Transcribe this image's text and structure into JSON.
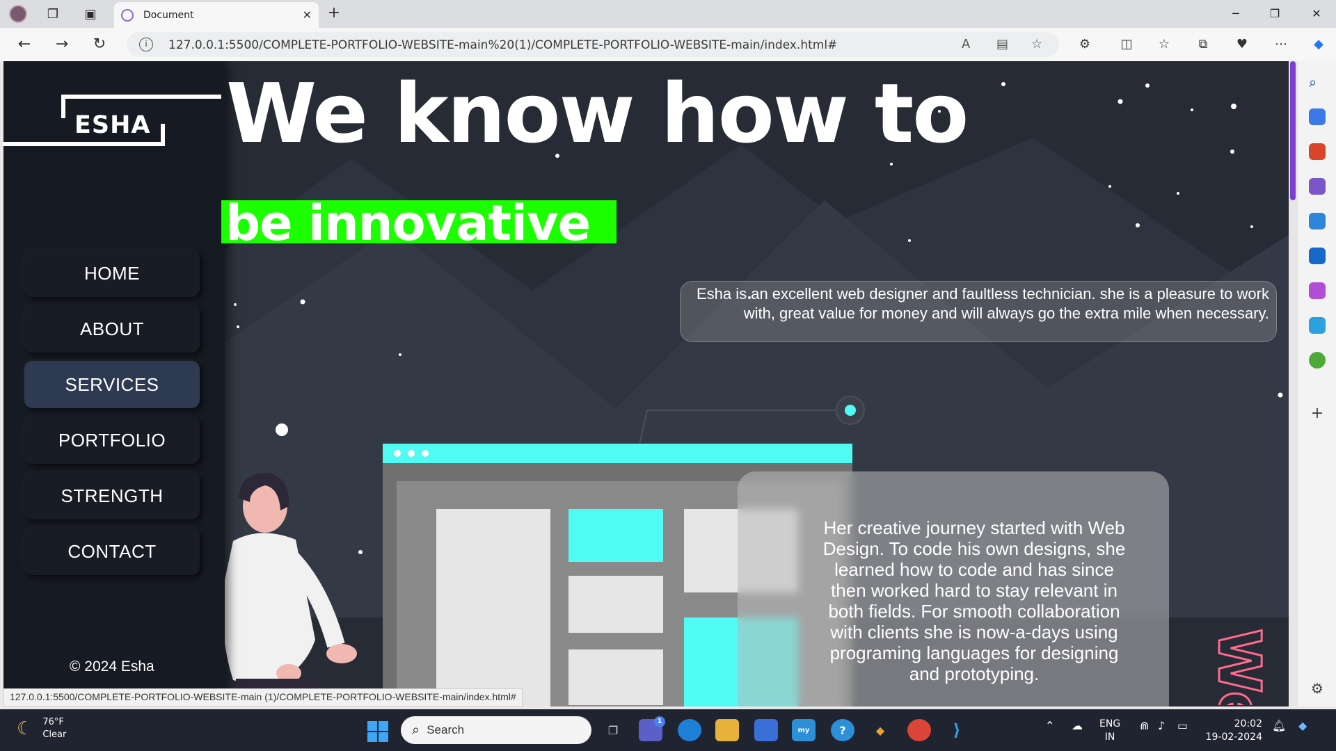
{
  "browser": {
    "tab_title": "Document",
    "url": "127.0.0.1:5500/COMPLETE-PORTFOLIO-WEBSITE-main%20(1)/COMPLETE-PORTFOLIO-WEBSITE-main/index.html#",
    "status_url": "127.0.0.1:5500/COMPLETE-PORTFOLIO-WEBSITE-main (1)/COMPLETE-PORTFOLIO-WEBSITE-main/index.html#"
  },
  "site": {
    "logo": "ESHA",
    "nav": [
      {
        "label": "HOME"
      },
      {
        "label": "ABOUT"
      },
      {
        "label": "SERVICES"
      },
      {
        "label": "PORTFOLIO"
      },
      {
        "label": "STRENGTH"
      },
      {
        "label": "CONTACT"
      }
    ],
    "active_nav": "SERVICES",
    "copyright": "© 2024 Esha",
    "headline": "We know how to",
    "subheadline": "be innovative",
    "quote": "Esha is an excellent web designer and faultless technician. she is a pleasure to work with, great value for money and will always go the extra mile when necessary.",
    "story": "Her creative journey started with Web Design. To code his own designs, she learned how to code and has since then worked hard to stay relevant in both fields. For smooth collaboration with clients she is now-a-days using programing languages for designing and prototyping.",
    "vertical_text": "We",
    "accent_color": "#1cff00",
    "illustration_color": "#4ffbf2"
  },
  "taskbar": {
    "weather_temp": "76°F",
    "weather_desc": "Clear",
    "search_placeholder": "Search",
    "lang_line1": "ENG",
    "lang_line2": "IN",
    "time": "20:02",
    "date": "19-02-2024",
    "teams_badge": "1"
  }
}
